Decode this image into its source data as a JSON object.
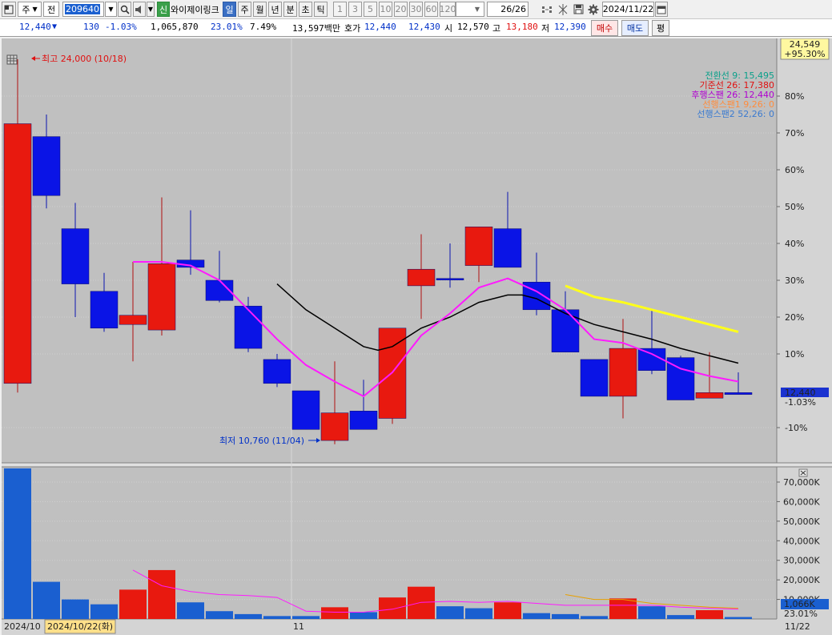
{
  "toolbar": {
    "market": "주",
    "prefix": "전",
    "code": "209640",
    "stock_name": "와이제이링크",
    "stock_tag": "신",
    "periods": [
      {
        "label": "일",
        "selected": true
      },
      {
        "label": "주",
        "selected": false
      },
      {
        "label": "월",
        "selected": false
      },
      {
        "label": "년",
        "selected": false
      },
      {
        "label": "분",
        "selected": false
      },
      {
        "label": "초",
        "selected": false
      },
      {
        "label": "틱",
        "selected": false
      }
    ],
    "intervals": [
      "1",
      "3",
      "5",
      "10",
      "20",
      "30",
      "60",
      "120"
    ],
    "count": "26",
    "count_total": "/26",
    "date": "2024/11/22"
  },
  "quote": {
    "price": "12,440",
    "arrow": "▼",
    "change": "130",
    "change_pct": "-1.03%",
    "volume": "1,065,870",
    "turnover": "23.01%",
    "ratio": "7.49%",
    "amount": "13,597백만",
    "ask_label": "호가",
    "ask": "12,440",
    "bid": "12,430",
    "open_label": "시",
    "open": "12,570",
    "high_label": "고",
    "high": "13,180",
    "low_label": "저",
    "low": "12,390",
    "buy_label": "매수",
    "sell_label": "매도",
    "eval_label": "평"
  },
  "annotations": {
    "max_label": "최고 24,000 (10/18)",
    "min_label": "최저 10,760 (11/04)",
    "top_right_price": "24,549",
    "top_right_pct": "+95.30%",
    "current_price": "12,440",
    "current_pct": "-1.03%",
    "current_volume": "1,066K",
    "current_turnover": "23.01%"
  },
  "legend": [
    {
      "label": "전환선 9: 15,495",
      "color": "#0aa08a"
    },
    {
      "label": "기준선 26: 17,380",
      "color": "#e01010"
    },
    {
      "label": "후행스팬 26: 12,440",
      "color": "#b000d0"
    },
    {
      "label": "선행스팬1 9,26: 0",
      "color": "#ff8c3c"
    },
    {
      "label": "선행스팬2 52,26: 0",
      "color": "#3a7ad0"
    }
  ],
  "x_labels": {
    "start": "2024/10",
    "highlight": "2024/10/22(화)",
    "month": "11",
    "end": "11/22"
  },
  "colors": {
    "up": "#e8190f",
    "down": "#0a14e6",
    "volume_down": "#1a5fd0",
    "lagging_span": "#ff1aff",
    "ma_black": "#000000",
    "leading_yellow": "#ffff1a",
    "bg": "#c0c0c0"
  },
  "chart_data": [
    {
      "type": "candlestick",
      "ylabel_ticks": [
        "80%",
        "70%",
        "60%",
        "50%",
        "40%",
        "30%",
        "20%",
        "10%",
        "-10%"
      ],
      "ytick_values": [
        80,
        70,
        60,
        50,
        40,
        30,
        20,
        10,
        -10
      ],
      "ylim_pct": [
        -20,
        95
      ],
      "series": [
        {
          "name": "candles",
          "values": [
            {
              "o": 72.5,
              "c": 2,
              "h": 90,
              "l": -0.5,
              "dir": "up"
            },
            {
              "o": 69,
              "c": 53,
              "h": 75,
              "l": 49.5,
              "dir": "down"
            },
            {
              "o": 44,
              "c": 29,
              "h": 51,
              "l": 20,
              "dir": "down"
            },
            {
              "o": 27,
              "c": 17,
              "h": 32,
              "l": 16,
              "dir": "down"
            },
            {
              "o": 18,
              "c": 20.5,
              "h": 35,
              "l": 8,
              "dir": "up"
            },
            {
              "o": 16.5,
              "c": 34.5,
              "h": 52.5,
              "l": 15,
              "dir": "up"
            },
            {
              "o": 35.5,
              "c": 33.5,
              "h": 49,
              "l": 31.5,
              "dir": "down"
            },
            {
              "o": 30,
              "c": 24.5,
              "h": 38,
              "l": 24,
              "dir": "down"
            },
            {
              "o": 23,
              "c": 11.5,
              "h": 25.5,
              "l": 10.5,
              "dir": "down"
            },
            {
              "o": 8.5,
              "c": 2,
              "h": 10,
              "l": 1,
              "dir": "down"
            },
            {
              "o": 0,
              "c": -10.5,
              "h": 0,
              "l": -10.5,
              "dir": "down"
            },
            {
              "o": -13.5,
              "c": -6,
              "h": 8,
              "l": -14.5,
              "dir": "up"
            },
            {
              "o": -5.5,
              "c": -10.5,
              "h": 3,
              "l": -10.5,
              "dir": "down"
            },
            {
              "o": -7.5,
              "c": 17,
              "h": 17,
              "l": -9,
              "dir": "up"
            },
            {
              "o": 28.5,
              "c": 33,
              "h": 42.5,
              "l": 19.5,
              "dir": "up"
            },
            {
              "o": 30.5,
              "c": 30.5,
              "h": 40,
              "l": 28,
              "dir": "down"
            },
            {
              "o": 34,
              "c": 44.5,
              "h": 44.5,
              "l": 29.5,
              "dir": "up"
            },
            {
              "o": 44,
              "c": 33.5,
              "h": 54,
              "l": 33.5,
              "dir": "down"
            },
            {
              "o": 29.5,
              "c": 22,
              "h": 37.5,
              "l": 20.5,
              "dir": "down"
            },
            {
              "o": 22,
              "c": 10.5,
              "h": 27,
              "l": 10.5,
              "dir": "down"
            },
            {
              "o": 8.5,
              "c": -1.5,
              "h": 8.5,
              "l": -1.5,
              "dir": "down"
            },
            {
              "o": -1.5,
              "c": 11.5,
              "h": 19.5,
              "l": -7.5,
              "dir": "up"
            },
            {
              "o": 11.5,
              "c": 5.5,
              "h": 22,
              "l": 4.5,
              "dir": "down"
            },
            {
              "o": 9,
              "c": -2.5,
              "h": 9.5,
              "l": -2.5,
              "dir": "down"
            },
            {
              "o": -2,
              "c": -0.5,
              "h": 10.5,
              "l": -2,
              "dir": "up"
            },
            {
              "o": -0.5,
              "c": -1,
              "h": 5,
              "l": -1,
              "dir": "down"
            }
          ]
        },
        {
          "name": "lagging_magenta",
          "points": [
            [
              4,
              35
            ],
            [
              5,
              35
            ],
            [
              6,
              34
            ],
            [
              7,
              30
            ],
            [
              8,
              22
            ],
            [
              9,
              14
            ],
            [
              10,
              7
            ],
            [
              11,
              2.5
            ],
            [
              12,
              -1.5
            ],
            [
              13,
              5
            ],
            [
              14,
              15
            ],
            [
              15,
              21
            ],
            [
              16,
              28
            ],
            [
              17,
              30.5
            ],
            [
              18,
              27
            ],
            [
              19,
              22
            ],
            [
              20,
              14
            ],
            [
              21,
              13
            ],
            [
              22,
              10
            ],
            [
              23,
              6
            ],
            [
              24,
              4
            ],
            [
              25,
              2.5
            ]
          ]
        },
        {
          "name": "ma_black",
          "points": [
            [
              9,
              29
            ],
            [
              10,
              22
            ],
            [
              11,
              17
            ],
            [
              12,
              12
            ],
            [
              12.5,
              11
            ],
            [
              13,
              12
            ],
            [
              14,
              17
            ],
            [
              15,
              20
            ],
            [
              16,
              24
            ],
            [
              17,
              26
            ],
            [
              17.5,
              26
            ],
            [
              18,
              25
            ],
            [
              19,
              21
            ],
            [
              20,
              18
            ],
            [
              21,
              16
            ],
            [
              22,
              14
            ],
            [
              23,
              11.5
            ],
            [
              24,
              9.5
            ],
            [
              25,
              7.5
            ]
          ]
        },
        {
          "name": "leading_yellow",
          "points": [
            [
              19,
              28.5
            ],
            [
              20,
              25.5
            ],
            [
              21,
              24
            ],
            [
              22,
              22
            ],
            [
              23,
              20
            ],
            [
              24,
              18
            ],
            [
              25,
              16
            ]
          ]
        }
      ]
    },
    {
      "type": "bar",
      "ylabel_ticks": [
        "70,000K",
        "60,000K",
        "50,000K",
        "40,000K",
        "30,000K",
        "20,000K",
        "10,000K"
      ],
      "ytick_values": [
        70000,
        60000,
        50000,
        40000,
        30000,
        20000,
        10000
      ],
      "ylim": [
        0,
        77000
      ],
      "values_k": [
        77000,
        19000,
        10000,
        7500,
        15000,
        25000,
        8500,
        4000,
        2500,
        1500,
        1500,
        6000,
        3500,
        11000,
        16500,
        6500,
        5500,
        8500,
        3000,
        2500,
        1500,
        10500,
        6500,
        2000,
        4500,
        1000
      ],
      "dirs": [
        "down",
        "down",
        "down",
        "down",
        "up",
        "up",
        "down",
        "down",
        "down",
        "down",
        "down",
        "up",
        "down",
        "up",
        "up",
        "down",
        "down",
        "up",
        "down",
        "down",
        "down",
        "up",
        "down",
        "down",
        "up",
        "down"
      ],
      "series": [
        {
          "name": "volume_magenta_line",
          "points": [
            [
              4,
              25000
            ],
            [
              5,
              17000
            ],
            [
              6,
              14000
            ],
            [
              7,
              12500
            ],
            [
              8,
              12000
            ],
            [
              9,
              11000
            ],
            [
              10,
              4000
            ],
            [
              11,
              3500
            ],
            [
              12,
              3500
            ],
            [
              13,
              5000
            ],
            [
              14,
              8500
            ],
            [
              15,
              9000
            ],
            [
              16,
              8500
            ],
            [
              17,
              9000
            ],
            [
              18,
              8000
            ],
            [
              19,
              7000
            ],
            [
              20,
              7000
            ],
            [
              21,
              7000
            ],
            [
              22,
              7000
            ],
            [
              23,
              6000
            ],
            [
              24,
              5500
            ],
            [
              25,
              5000
            ]
          ]
        },
        {
          "name": "volume_orange_line",
          "points": [
            [
              19,
              12500
            ],
            [
              20,
              10000
            ],
            [
              21,
              10000
            ],
            [
              22,
              8000
            ],
            [
              23,
              7000
            ],
            [
              24,
              6000
            ],
            [
              25,
              5500
            ]
          ]
        }
      ]
    }
  ]
}
